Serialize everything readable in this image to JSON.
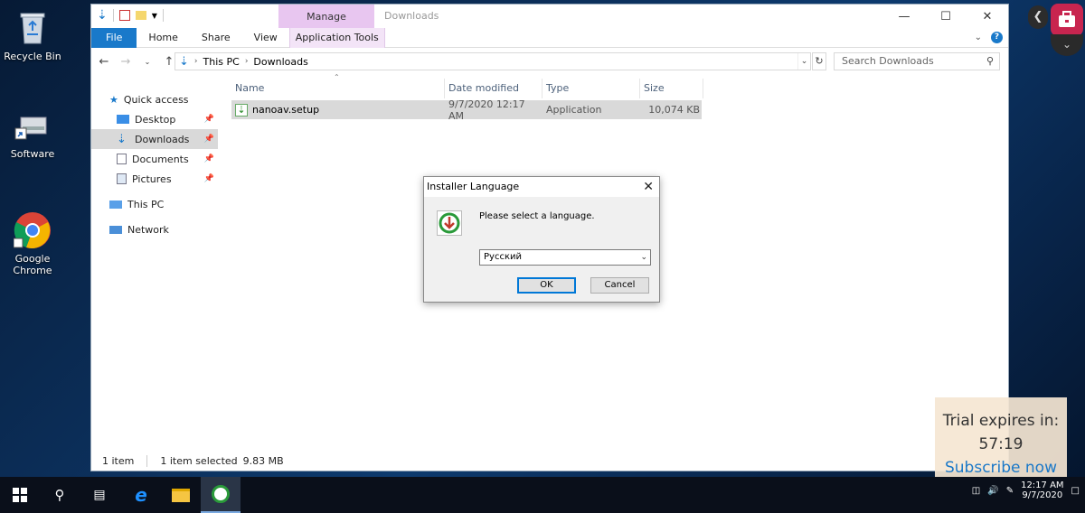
{
  "desktop": {
    "icons": [
      {
        "label": "Recycle Bin"
      },
      {
        "label": "Software"
      },
      {
        "label": "Google\nChrome"
      }
    ]
  },
  "explorer": {
    "window_title": "Downloads",
    "ribbon": {
      "manage_label": "Manage",
      "tabs": [
        "File",
        "Home",
        "Share",
        "View",
        "Application Tools"
      ]
    },
    "address": {
      "crumbs": [
        "This PC",
        "Downloads"
      ],
      "search_placeholder": "Search Downloads"
    },
    "nav": {
      "quick_access": "Quick access",
      "items": [
        {
          "label": "Desktop",
          "pinned": true
        },
        {
          "label": "Downloads",
          "pinned": true,
          "selected": true
        },
        {
          "label": "Documents",
          "pinned": true
        },
        {
          "label": "Pictures",
          "pinned": true
        }
      ],
      "this_pc": "This PC",
      "network": "Network"
    },
    "columns": [
      "Name",
      "Date modified",
      "Type",
      "Size"
    ],
    "files": [
      {
        "name": "nanoav.setup",
        "date": "9/7/2020 12:17 AM",
        "type": "Application",
        "size": "10,074 KB"
      }
    ],
    "status": {
      "count": "1 item",
      "selected": "1 item selected",
      "size": "9.83 MB"
    }
  },
  "dialog": {
    "title": "Installer Language",
    "message": "Please select a language.",
    "selected_language": "Русский",
    "ok_label": "OK",
    "cancel_label": "Cancel"
  },
  "trial": {
    "line1": "Trial expires in:",
    "timer": "57:19",
    "cta": "Subscribe now"
  },
  "taskbar": {
    "time": "12:17 AM",
    "date": "9/7/2020"
  },
  "colors": {
    "accent": "#1979ca",
    "manage_tab": "#e8c6f0",
    "side_red": "#c8254f"
  }
}
